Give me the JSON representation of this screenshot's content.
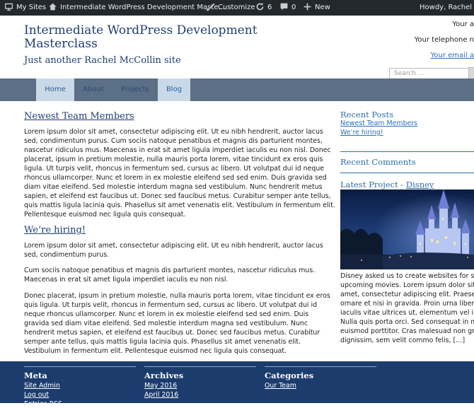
{
  "adminbar": {
    "my_sites": "My Sites",
    "site_name": "Intermediate WordPress Development Maste...",
    "customize": "Customize",
    "updates_count": "6",
    "comments_count": "0",
    "new_label": "New",
    "howdy": "Howdy, Rachel Mc"
  },
  "header": {
    "title": "Intermediate WordPress Development Masterclass",
    "description": "Just another Rachel McCollin site",
    "contact_line1": "Your a",
    "contact_line2": "Your telephone n",
    "contact_email": "Your email a",
    "search_placeholder": "Search ..."
  },
  "nav": {
    "items": [
      {
        "label": "Home"
      },
      {
        "label": "About"
      },
      {
        "label": "Projects"
      },
      {
        "label": "Blog"
      }
    ]
  },
  "posts": [
    {
      "title": "Newest Team Members",
      "paragraphs": [
        "Lorem ipsum dolor sit amet, consectetur adipiscing elit. Ut eu nibh hendrerit, auctor lacus sed, condimentum purus. Cum sociis natoque penatibus et magnis dis parturient montes, nascetur ridiculus mus. Maecenas in erat sit amet ligula imperdiet iaculis eu non nisl. Donec placerat, ipsum in pretium molestie, nulla mauris porta lorem, vitae tincidunt ex eros quis ligula. Ut turpis velit, rhoncus in fermentum sed, cursus ac libero. Ut volutpat dui id neque rhoncus ullamcorper. Nunc et lorem in ex molestie eleifend sed sed enim. Duis gravida sed diam vitae eleifend. Sed molestie interdum magna sed vestibulum. Nunc hendrerit metus sapien, et eleifend est faucibus ut. Donec sed faucibus metus. Curabitur semper ante tellus, quis mattis ligula lacinia quis. Phasellus sit amet venenatis elit. Vestibulum in fermentum elit. Pellentesque euismod nec ligula quis consequat."
      ]
    },
    {
      "title": "We’re hiring!",
      "paragraphs": [
        "Lorem ipsum dolor sit amet, consectetur adipiscing elit. Ut eu nibh hendrerit, auctor lacus sed, condimentum purus.",
        "Cum sociis natoque penatibus et magnis dis parturient montes, nascetur ridiculus mus. Maecenas in erat sit amet ligula imperdiet iaculis eu non nisl.",
        "Donec placerat, ipsum in pretium molestie, nulla mauris porta lorem, vitae tincidunt ex eros quis ligula. Ut turpis velit, rhoncus in fermentum sed, cursus ac libero. Ut volutpat dui id neque rhoncus ullamcorper. Nunc et lorem in ex molestie eleifend sed sed enim. Duis gravida sed diam vitae eleifend. Sed molestie interdum magna sed vestibulum. Nunc hendrerit metus sapien, et eleifend est faucibus ut. Donec sed faucibus metus. Curabitur semper ante tellus, quis mattis ligula lacinia quis. Phasellus sit amet venenatis elit. Vestibulum in fermentum elit. Pellentesque euismod nec ligula quis consequat."
      ]
    }
  ],
  "sidebar": {
    "recent_posts_title": "Recent Posts",
    "recent_posts": [
      "Newest Team Members",
      "We’re hiring!"
    ],
    "recent_comments_title": "Recent Comments",
    "latest_project_prefix": "Latest Project - ",
    "latest_project_link": "Disney",
    "project_text": "Disney asked us to create websites for s upcoming movies. Lorem ipsum dolor sit amet, consectetur adipiscing elit. Praese ornare et nisi in gravida. Proin urna liber iaculis vitae ultrices ut, elementum vel ip Nulla quis porta orci. Sed consequat in massa euismod porttitor. Cras malesuad non gravida dignissim, sem velit commo felis,",
    "read_more": "[…]"
  },
  "footer": {
    "meta_title": "Meta",
    "meta_links": [
      "Site Admin",
      "Log out",
      "Entries RSS"
    ],
    "archives_title": "Archives",
    "archives_links": [
      "May 2016",
      "April 2016"
    ],
    "categories_title": "Categories",
    "categories_links": [
      "Our Team"
    ]
  },
  "colors": {
    "adminbar_bg": "#23282d",
    "title_blue": "#1e3d73",
    "nav_bg": "#5b6f87",
    "nav_active_bg": "#c9d9e8",
    "footer_bg": "#1c3c6e",
    "link_blue": "#2a70b8"
  },
  "icons": {
    "my_sites": "house-icon",
    "site": "home-icon",
    "customize": "paintbrush-icon",
    "updates": "refresh-icon",
    "comments": "comment-bubble-icon",
    "new": "plus-icon"
  }
}
